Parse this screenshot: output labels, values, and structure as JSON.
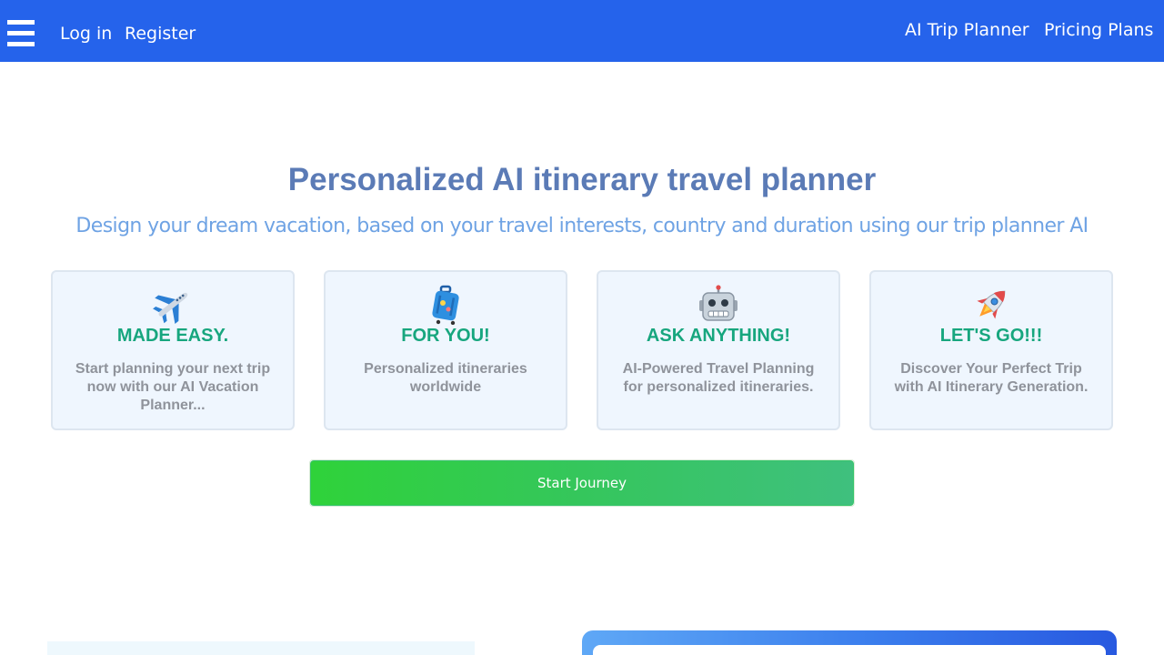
{
  "nav": {
    "login": "Log in",
    "register": "Register",
    "ai_trip_planner": "AI Trip Planner",
    "pricing_plans": "Pricing Plans"
  },
  "hero": {
    "title": "Personalized AI itinerary travel planner",
    "subtitle": "Design your dream vacation, based on your travel interests, country and duration using our trip planner AI"
  },
  "features": [
    {
      "icon": "airplane-icon",
      "title": "MADE EASY.",
      "description": "Start planning your next trip now with our AI Vacation Planner..."
    },
    {
      "icon": "luggage-icon",
      "title": "FOR YOU!",
      "description": "Personalized itineraries worldwide"
    },
    {
      "icon": "robot-icon",
      "title": "ASK ANYTHING!",
      "description": "AI-Powered Travel Planning for personalized itineraries."
    },
    {
      "icon": "rocket-icon",
      "title": "LET'S GO!!!",
      "description": "Discover Your Perfect Trip with AI Itinerary Generation."
    }
  ],
  "cta": {
    "start_label": "Start Journey"
  },
  "colors": {
    "navbar": "#2563eb",
    "hero_title": "#5b7bb6",
    "hero_subtitle": "#6fa3e4",
    "card_title": "#17a67e",
    "card_text": "#8f939b",
    "cta_start": "#2fd23a",
    "cta_end": "#3fc07e"
  }
}
